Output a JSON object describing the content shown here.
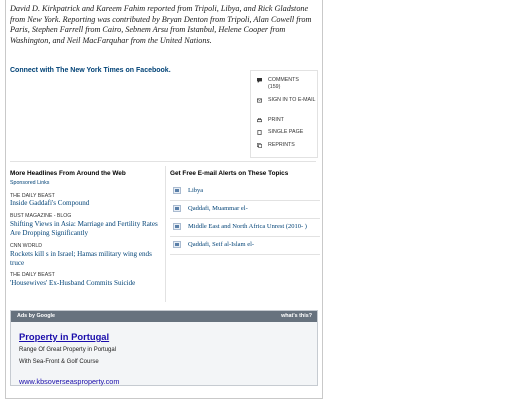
{
  "article": {
    "credit_text": "David D. Kirkpatrick and Kareem Fahim reported from Tripoli, Libya, and Rick Gladstone from New York. Reporting was contributed by Bryan Denton from Tripoli, Alan Cowell from Paris, Stephen Farrell from Cairo, Sebnem Arsu from Istanbul, Helene Cooper from Washington, and Neil MacFarquhar from the United Nations.",
    "facebook_link": "Connect with The New York Times on Facebook."
  },
  "tools": {
    "comments_label": "COMMENTS",
    "comments_count": "(159)",
    "sign_in_label": "SIGN IN TO E-MAIL",
    "print_label": "PRINT",
    "single_page_label": "SINGLE PAGE",
    "reprints_label": "REPRINTS"
  },
  "headlines": {
    "heading": "More Headlines From Around the Web",
    "sponsored": "Sponsored Links",
    "items": [
      {
        "source": "THE DAILY BEAST",
        "title": "Inside Gaddafi's Compound"
      },
      {
        "source": "BUST MAGAZINE - BLOG",
        "title": "Shifting Views in Asia: Marriage and Fertility Rates Are Dropping Significantly"
      },
      {
        "source": "CNN WORLD",
        "title": "Rockets kill s in Israel; Hamas military wing ends truce"
      },
      {
        "source": "THE DAILY BEAST",
        "title": "'Housewives' Ex-Husband Commits Suicide"
      }
    ]
  },
  "alerts": {
    "heading": "Get Free E-mail Alerts on These Topics",
    "topics": [
      "Libya",
      "Qaddafi, Muammar el-",
      "Middle East and North Africa Unrest (2010- )",
      "Qaddafi, Seif al-Islam el-"
    ]
  },
  "ads": {
    "ads_by": "Ads by Google",
    "whats_this": "what's this?",
    "title": "Property in Portugal",
    "line1": "Range Of Great Property in Portugal",
    "line2": "With Sea-Front & Golf Course",
    "url": "www.kbsoverseasproperty.com"
  }
}
